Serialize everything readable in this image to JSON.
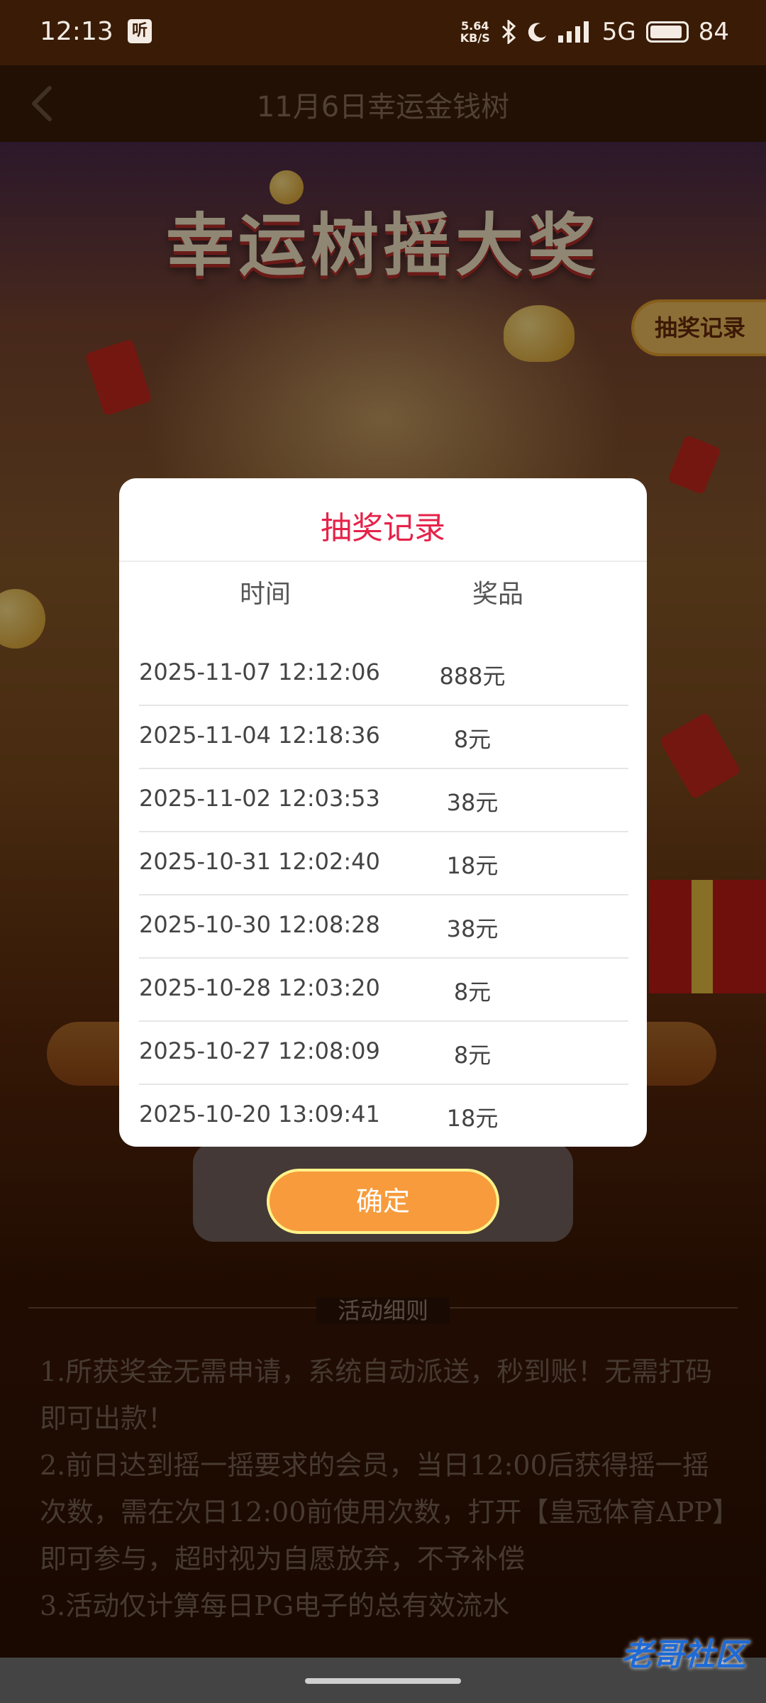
{
  "status_bar": {
    "time": "12:13",
    "app_badge": "听",
    "net_speed_value": "5.64",
    "net_speed_unit": "KB/S",
    "network": "5G",
    "battery": "84"
  },
  "header": {
    "title": "11月6日幸运金钱树"
  },
  "banner": {
    "title": "幸运树摇大奖",
    "record_tab": "抽奖记录"
  },
  "modal": {
    "title": "抽奖记录",
    "col_time": "时间",
    "col_prize": "奖品",
    "rows": [
      {
        "time": "2025-11-07 12:12:06",
        "prize": "888元"
      },
      {
        "time": "2025-11-04 12:18:36",
        "prize": "8元"
      },
      {
        "time": "2025-11-02 12:03:53",
        "prize": "38元"
      },
      {
        "time": "2025-10-31 12:02:40",
        "prize": "18元"
      },
      {
        "time": "2025-10-30 12:08:28",
        "prize": "38元"
      },
      {
        "time": "2025-10-28 12:03:20",
        "prize": "8元"
      },
      {
        "time": "2025-10-27 12:08:09",
        "prize": "8元"
      },
      {
        "time": "2025-10-20 13:09:41",
        "prize": "18元"
      }
    ],
    "confirm": "确定"
  },
  "rules": {
    "heading": "活动细则",
    "lines": [
      "1.所获奖金无需申请，系统自动派送，秒到账！无需打码即可出款！",
      "2.前日达到摇一摇要求的会员，当日12:00后获得摇一摇次数，需在次日12:00前使用次数，打开【皇冠体育APP】即可参与，超时视为自愿放弃，不予补偿",
      "3.活动仅计算每日PG电子的总有效流水"
    ]
  },
  "watermark": "老哥社区"
}
